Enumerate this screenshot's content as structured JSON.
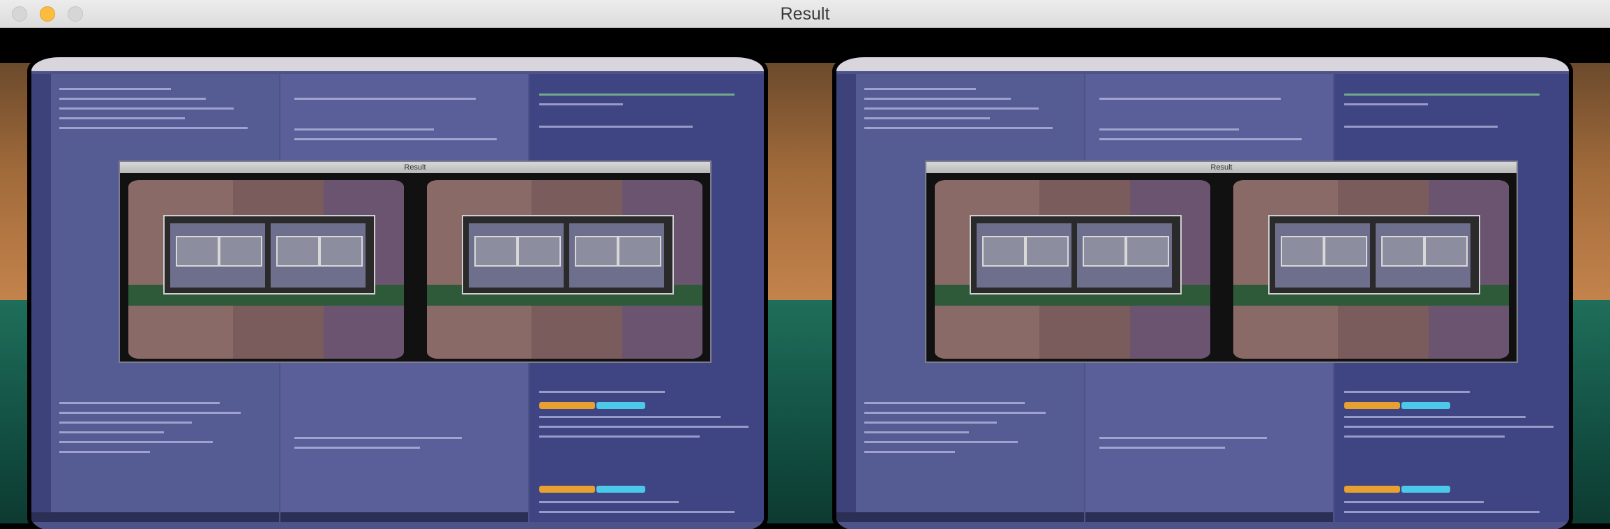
{
  "window": {
    "title": "Result",
    "colors": {
      "titlebar": "#e4e4e4",
      "minimize_button": "#fdbc40",
      "inactive_button": "#d6d6d6",
      "background": "#000000"
    }
  },
  "icons": {
    "close": "close-icon",
    "minimize": "minimize-icon",
    "zoom": "zoom-icon"
  },
  "stereo_view": {
    "inner_window_title": "Result"
  }
}
